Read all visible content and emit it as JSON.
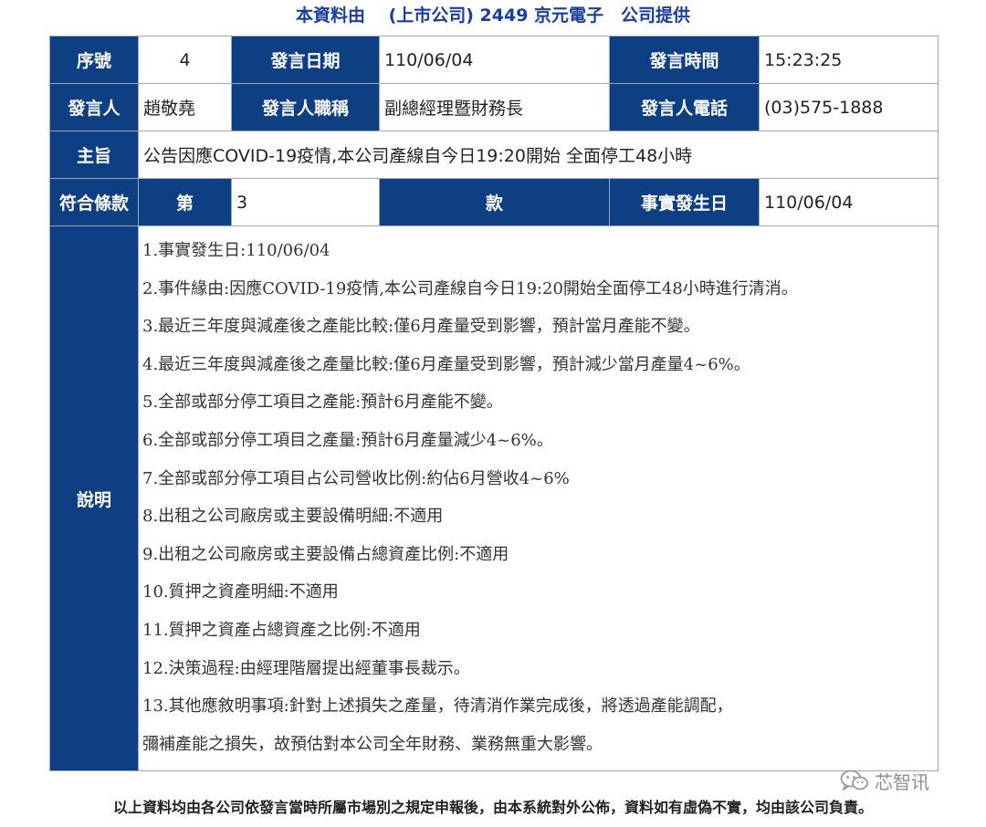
{
  "source": "本資料由　 (上市公司) 2449 京元電子　公司提供",
  "header": {
    "seq_label": "序號",
    "seq_value": "4",
    "date_label": "發言日期",
    "date_value": "110/06/04",
    "time_label": "發言時間",
    "time_value": "15:23:25",
    "speaker_label": "發言人",
    "speaker_value": "趙敬堯",
    "title_label": "發言人職稱",
    "title_value": "副總經理暨財務長",
    "phone_label": "發言人電話",
    "phone_value": "(03)575-1888",
    "subject_label": "主旨",
    "subject_value": "公告因應COVID-19疫情,本公司產線自今日19:20開始 全面停工48小時",
    "clause_label": "符合條款",
    "clause_prefix": "第",
    "clause_value": "3",
    "clause_suffix": "款",
    "fact_date_label": "事實發生日",
    "fact_date_value": "110/06/04"
  },
  "description": {
    "label": "說明",
    "lines": [
      "1.事實發生日:110/06/04",
      "2.事件緣由:因應COVID-19疫情,本公司產線自今日19:20開始全面停工48小時進行清消。",
      "3.最近三年度與減產後之產能比較:僅6月產量受到影響，預計當月產能不變。",
      "4.最近三年度與減產後之產量比較:僅6月產量受到影響，預計減少當月產量4~6%。",
      "5.全部或部分停工項目之產能:預計6月產能不變。",
      "6.全部或部分停工項目之產量:預計6月產量減少4~6%。",
      "7.全部或部分停工項目占公司營收比例:約佔6月營收4~6%",
      "8.出租之公司廠房或主要設備明細:不適用",
      "9.出租之公司廠房或主要設備占總資產比例:不適用",
      "10.質押之資產明細:不適用",
      "11.質押之資產占總資產之比例:不適用",
      "12.決策過程:由經理階層提出經董事長裁示。",
      "13.其他應敘明事項:針對上述損失之產量，待清消作業完成後，將透過產能調配，",
      "彌補產能之損失，故預估對本公司全年財務、業務無重大影響。"
    ]
  },
  "footer": "以上資料均由各公司依發言當時所屬市場別之規定申報後，由本系統對外公佈，資料如有虛偽不實，均由該公司負責。",
  "watermark": {
    "icon": "wechat-icon",
    "text": "芯智讯"
  },
  "colors": {
    "header_bg": "#0d3f82",
    "source_text": "#1a3e99",
    "border": "#9aa7b6"
  }
}
